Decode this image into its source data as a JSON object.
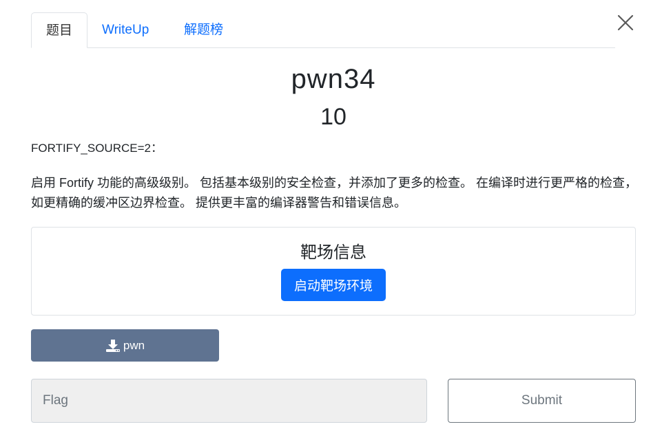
{
  "tabs": [
    {
      "label": "题目",
      "active": true
    },
    {
      "label": "WriteUp",
      "active": false
    },
    {
      "label": "解题榜",
      "active": false
    }
  ],
  "challenge": {
    "name": "pwn34",
    "score": "10",
    "description_heading": "FORTIFY_SOURCE=2：",
    "description_body": "启用 Fortify 功能的高级级别。 包括基本级别的安全检查，并添加了更多的检查。 在编译时进行更严格的检查，如更精确的缓冲区边界检查。 提供更丰富的编译器警告和错误信息。"
  },
  "range_card": {
    "title": "靶场信息",
    "start_button": "启动靶场环境"
  },
  "download": {
    "icon": "download-icon",
    "label": "pwn"
  },
  "flag_form": {
    "placeholder": "Flag",
    "value": "",
    "submit_label": "Submit"
  },
  "colors": {
    "primary": "#0d6efd",
    "download_bg": "#5f7391",
    "input_bg": "#efefef"
  }
}
